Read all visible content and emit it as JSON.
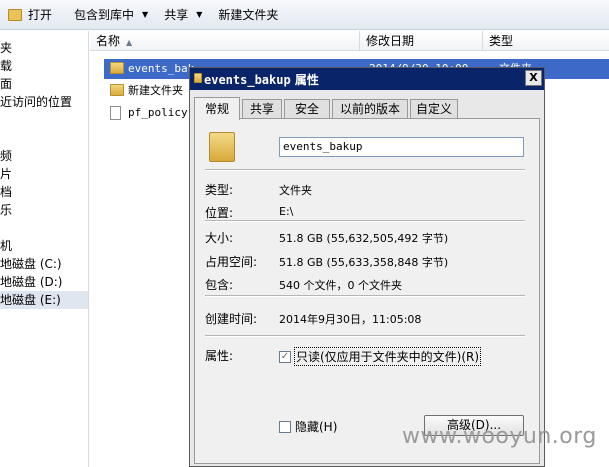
{
  "toolbar": {
    "open_label": "打开",
    "include_label": "包含到库中",
    "share_label": "共享",
    "new_folder_label": "新建文件夹"
  },
  "nav": {
    "items": [
      "夹",
      "载",
      "面",
      "近访问的位置",
      "频",
      "片",
      "档",
      "乐",
      "机",
      "地磁盘 (C:)",
      "地磁盘 (D:)",
      "地磁盘 (E:)"
    ]
  },
  "list": {
    "columns": [
      "名称",
      "修改日期",
      "类型"
    ],
    "rows": [
      {
        "name": "events_bak",
        "date": "2014/9/30 10:00",
        "type": "文件夹"
      },
      {
        "name": "新建文件夹",
        "date": "",
        "type": ""
      },
      {
        "name": "pf_policy",
        "date": "",
        "type": ""
      }
    ]
  },
  "dialog": {
    "title_name": "events_bakup",
    "title_suffix": " 属性",
    "close_glyph": "X",
    "tabs": [
      "常规",
      "共享",
      "安全",
      "以前的版本",
      "自定义"
    ],
    "name_value": "events_bakup",
    "props": [
      {
        "label": "类型:",
        "value": "文件夹"
      },
      {
        "label": "位置:",
        "value": "E:\\"
      },
      {
        "label": "大小:",
        "value": "51.8 GB (55,632,505,492 字节)"
      },
      {
        "label": "占用空间:",
        "value": "51.8 GB (55,633,358,848 字节)"
      },
      {
        "label": "包含:",
        "value": "540 个文件，0 个文件夹"
      },
      {
        "label": "创建时间:",
        "value": "2014年9月30日，11:05:08"
      }
    ],
    "attributes_label": "属性:",
    "readonly_label": "只读(仅应用于文件夹中的文件)(R)",
    "readonly_mark": "✓",
    "hidden_label": "隐藏(H)",
    "advanced_label": "高级(D)..."
  },
  "watermark": "www.wooyun.org"
}
